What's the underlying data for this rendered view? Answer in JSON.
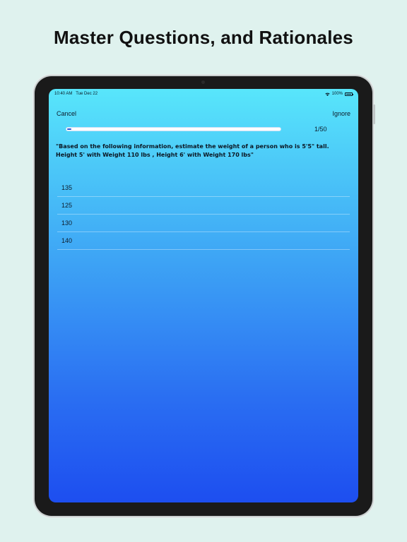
{
  "headline": "Master Questions, and Rationales",
  "status_bar": {
    "time": "10:40 AM",
    "date": "Tue Dec 22",
    "battery": "100%",
    "icons": [
      "wifi-icon",
      "battery-icon"
    ]
  },
  "nav": {
    "cancel_label": "Cancel",
    "ignore_label": "Ignore"
  },
  "progress": {
    "fraction": 0.02,
    "count_label": "1/50"
  },
  "question": {
    "text": "\"Based on the following information, estimate the weight of a person who is 5'5\" tall. Height 5' with Weight 110 lbs , Height 6' with Weight 170 lbs\""
  },
  "answers": [
    {
      "label": "135"
    },
    {
      "label": "125"
    },
    {
      "label": "130"
    },
    {
      "label": "140"
    }
  ],
  "colors": {
    "background": "#dff2ee",
    "gradient_top": "#58e6fb",
    "gradient_bottom": "#1d4ef0",
    "progress_fill": "#2a55d8"
  }
}
